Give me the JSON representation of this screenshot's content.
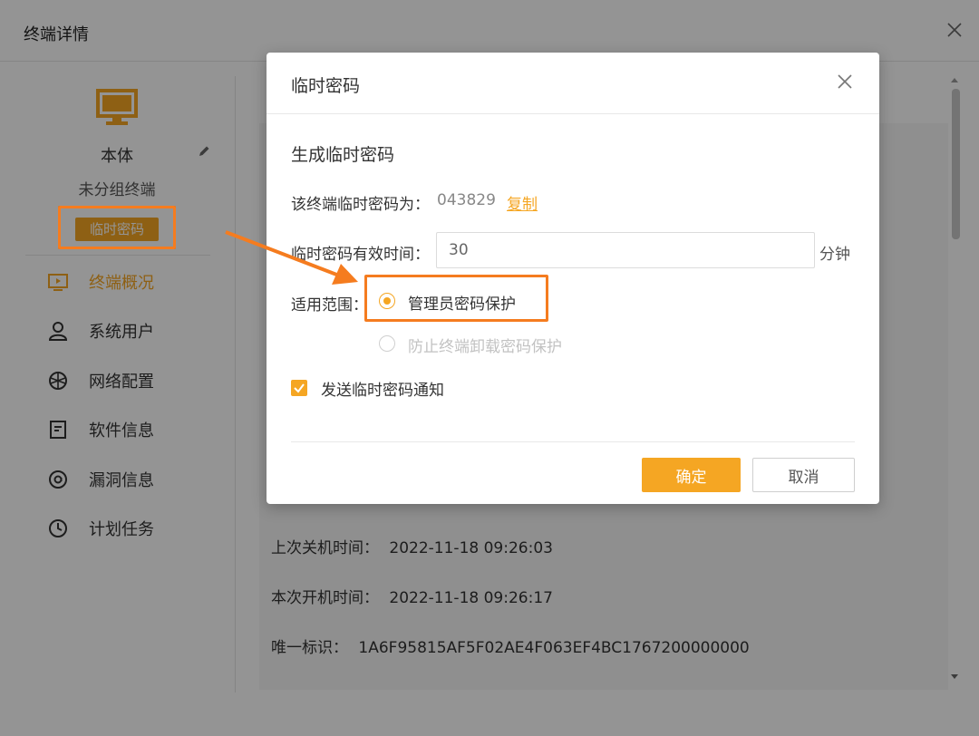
{
  "window": {
    "title": "终端详情"
  },
  "sidebar": {
    "device_name": "本体",
    "group_name": "未分组终端",
    "temp_password_button": "临时密码",
    "items": [
      {
        "label": "终端概况",
        "icon": "monitor-play-icon",
        "active": true
      },
      {
        "label": "系统用户",
        "icon": "user-icon",
        "active": false
      },
      {
        "label": "网络配置",
        "icon": "network-icon",
        "active": false
      },
      {
        "label": "软件信息",
        "icon": "document-icon",
        "active": false
      },
      {
        "label": "漏洞信息",
        "icon": "at-icon",
        "active": false
      },
      {
        "label": "计划任务",
        "icon": "clock-icon",
        "active": false
      }
    ]
  },
  "content": {
    "rows": [
      {
        "label": "上次关机时间：",
        "value": "2022-11-18 09:26:03"
      },
      {
        "label": "本次开机时间：",
        "value": "2022-11-18 09:26:17"
      },
      {
        "label": "唯一标识：",
        "value": "1A6F95815AF5F02AE4F063EF4BC1767200000000"
      }
    ]
  },
  "modal": {
    "title": "临时密码",
    "section_title": "生成临时密码",
    "password_label": "该终端临时密码为：",
    "password_value": "043829",
    "copy_label": "复制",
    "validity_label": "临时密码有效时间：",
    "validity_value": "30",
    "validity_unit": "分钟",
    "scope_label": "适用范围：",
    "scope_options": [
      {
        "label": "管理员密码保护",
        "checked": true,
        "disabled": false
      },
      {
        "label": "防止终端卸载密码保护",
        "checked": false,
        "disabled": true
      }
    ],
    "notify_label": "发送临时密码通知",
    "notify_checked": true,
    "ok_label": "确定",
    "cancel_label": "取消"
  },
  "colors": {
    "accent": "#f5a623",
    "highlight": "#f57c1f"
  }
}
